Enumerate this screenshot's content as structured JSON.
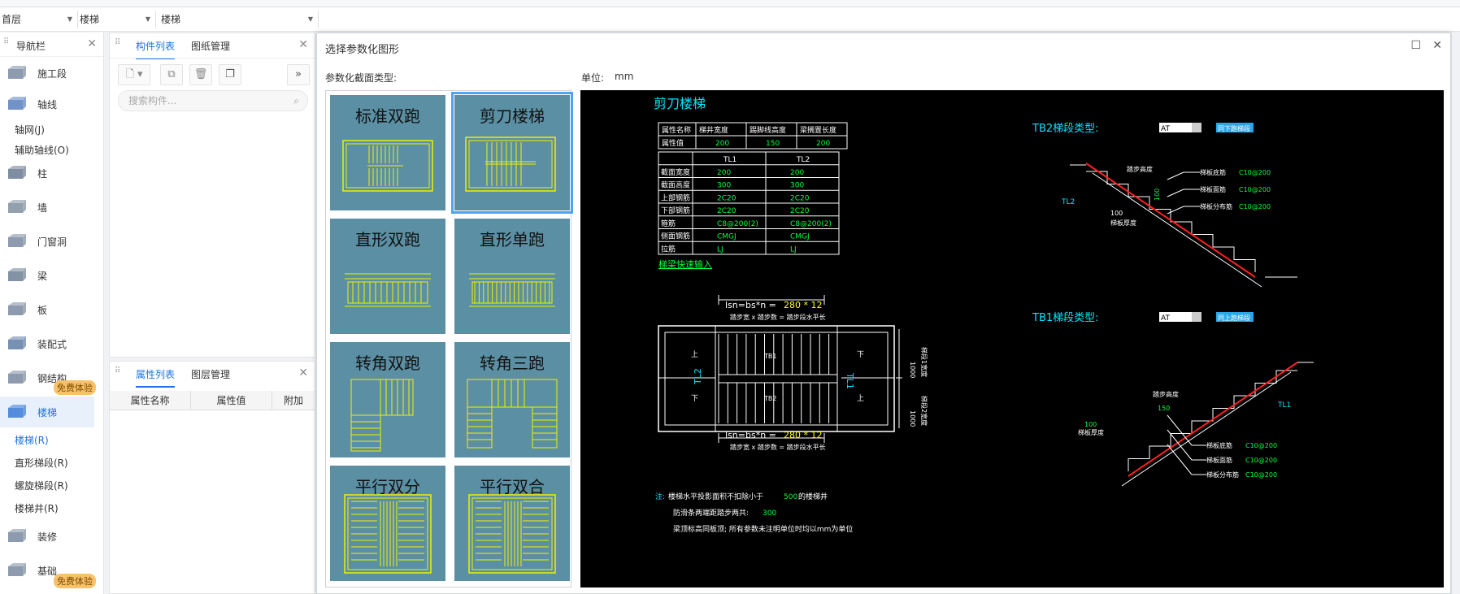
{
  "floor_bar": {
    "floor": "首层",
    "category": "楼梯",
    "subcategory": "楼梯"
  },
  "nav": {
    "title": "导航栏",
    "items": [
      {
        "label": "施工段",
        "icon": "construction-segment-icon"
      },
      {
        "label": "轴线",
        "icon": "grid-axis-icon"
      },
      {
        "label": "柱",
        "icon": "column-icon"
      },
      {
        "label": "墙",
        "icon": "wall-icon"
      },
      {
        "label": "门窗洞",
        "icon": "door-window-icon"
      },
      {
        "label": "梁",
        "icon": "beam-icon"
      },
      {
        "label": "板",
        "icon": "slab-icon"
      },
      {
        "label": "装配式",
        "icon": "prefab-icon"
      },
      {
        "label": "钢结构",
        "icon": "steel-structure-icon"
      },
      {
        "label": "楼梯",
        "icon": "stair-icon"
      },
      {
        "label": "装修",
        "icon": "decoration-icon"
      },
      {
        "label": "基础",
        "icon": "foundation-icon"
      }
    ],
    "axis_subs": [
      "轴网(J)",
      "辅助轴线(O)"
    ],
    "stair_subs": [
      "楼梯(R)",
      "直形梯段(R)",
      "螺旋梯段(R)",
      "楼梯井(R)"
    ],
    "trial_badge": "免费体验"
  },
  "component_panel": {
    "tabs": [
      "构件列表",
      "图纸管理"
    ],
    "search_placeholder": "搜索构件..."
  },
  "property_panel": {
    "tabs": [
      "属性列表",
      "图层管理"
    ],
    "columns": [
      "属性名称",
      "属性值",
      "附加"
    ]
  },
  "dialog": {
    "title": "选择参数化图形",
    "section_type_label": "参数化截面类型:",
    "unit_label": "单位:",
    "unit_value": "mm",
    "thumbnails": [
      "标准双跑",
      "剪刀楼梯",
      "直形双跑",
      "直形单跑",
      "转角双跑",
      "转角三跑",
      "平行双分",
      "平行双合"
    ],
    "selected_index": 1
  },
  "preview": {
    "title": "剪刀楼梯",
    "top_table": {
      "headers": [
        "属性名称",
        "梯井宽度",
        "踢脚线高度",
        "梁搁置长度"
      ],
      "row": [
        "属性值",
        "200",
        "150",
        "200"
      ]
    },
    "tl_table": {
      "headers": [
        "",
        "TL1",
        "TL2"
      ],
      "rows": [
        [
          "截面宽度",
          "200",
          "200"
        ],
        [
          "截面高度",
          "300",
          "300"
        ],
        [
          "上部钢筋",
          "2C20",
          "2C20"
        ],
        [
          "下部钢筋",
          "2C20",
          "2C20"
        ],
        [
          "箍筋",
          "C8@200(2)",
          "C8@200(2)"
        ],
        [
          "侧面钢筋",
          "CMGJ",
          "CMGJ"
        ],
        [
          "拉筋",
          "LJ",
          "LJ"
        ]
      ]
    },
    "quick_input": "梯梁快速输入",
    "lsn_top": "lsn=bs*n = ",
    "lsn_top_val": "280 * 12",
    "lsn_top_sub": "踏步宽 x 踏步数 = 踏步段水平长",
    "lsn_bot": "lsn=bs*n = ",
    "lsn_bot_val": "280 * 12",
    "lsn_bot_sub": "踏步宽 x 踏步数 = 踏步段水平长",
    "plan_labels": {
      "tl2": "TL2",
      "tl1": "TL1",
      "tb1": "TB1",
      "tb2": "TB2",
      "up": "上",
      "down": "下",
      "dim1": "1000",
      "dim2": "1000",
      "side1": "梯段1宽度",
      "side2": "梯段2宽度"
    },
    "notes": {
      "prefix": "注:",
      "line1a": "楼梯水平投影面积不扣除小于 ",
      "line1v": "500",
      "line1b": " 的楼梯井",
      "line2a": "防滑条两端距踏步两共:",
      "line2v": "300",
      "line3": "梁顶标高同板顶; 所有参数未注明单位时均以mm为单位"
    },
    "tb2": {
      "label": "TB2梯段类型:",
      "type": "AT",
      "btn": "同下跑梯段",
      "step_height": "踏步高度",
      "val100": "100",
      "thick": "梯板厚度",
      "val100b": "100",
      "tl": "TL2",
      "rebars": [
        [
          "梯板底筋",
          "C10@200"
        ],
        [
          "梯板面筋",
          "C10@200"
        ],
        [
          "梯板分布筋",
          "C10@200"
        ]
      ]
    },
    "tb1": {
      "label": "TB1梯段类型:",
      "type": "AT",
      "btn": "同上跑梯段",
      "step_height": "踏步高度",
      "val150": "150",
      "val100": "100",
      "thick": "梯板厚度",
      "tl": "TL1",
      "rebars": [
        [
          "梯板底筋",
          "C10@200"
        ],
        [
          "梯板面筋",
          "C10@200"
        ],
        [
          "梯板分布筋",
          "C10@200"
        ]
      ]
    },
    "colors": {
      "cyan": "#00e5ff",
      "green": "#00ff3c",
      "yellow": "#ffff00",
      "red": "#ff2020",
      "white": "#ffffff",
      "blue_btn": "#2aa7e8"
    }
  }
}
